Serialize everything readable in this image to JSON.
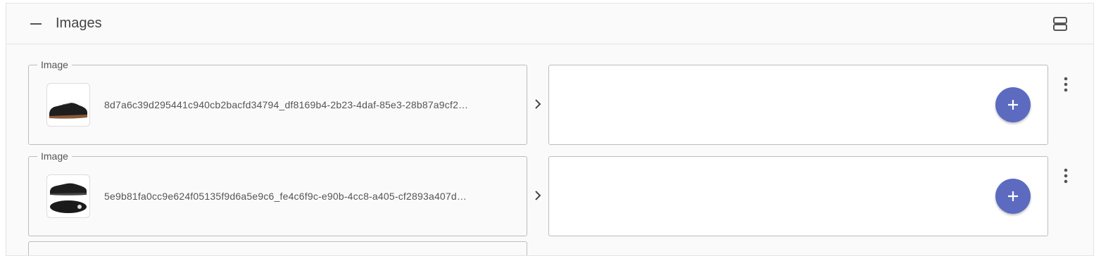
{
  "section": {
    "title": "Images",
    "collapse_icon": "minus-icon",
    "layout_icon": "view-agenda-icon"
  },
  "images": [
    {
      "legend": "Image",
      "file_name": "8d7a6c39d295441c940cb2bacfd34794_df8169b4-2b23-4daf-85e3-28b87a9cf2…",
      "thumbnail": "black-leather-shoe-side-view"
    },
    {
      "legend": "Image",
      "file_name": "5e9b81fa0cc9e624f05135f9d6a5e9c6_fe4c6f9c-e90b-4cc8-a405-cf2893a407d…",
      "thumbnail": "black-leather-shoe-side-and-sole-view"
    }
  ],
  "icons": {
    "chevron": "chevron-right-icon",
    "add": "plus-icon",
    "more": "more-vertical-icon"
  },
  "colors": {
    "accent": "#5c6bc0",
    "panel_background": "#fafafa",
    "border": "#bdbdbd"
  }
}
